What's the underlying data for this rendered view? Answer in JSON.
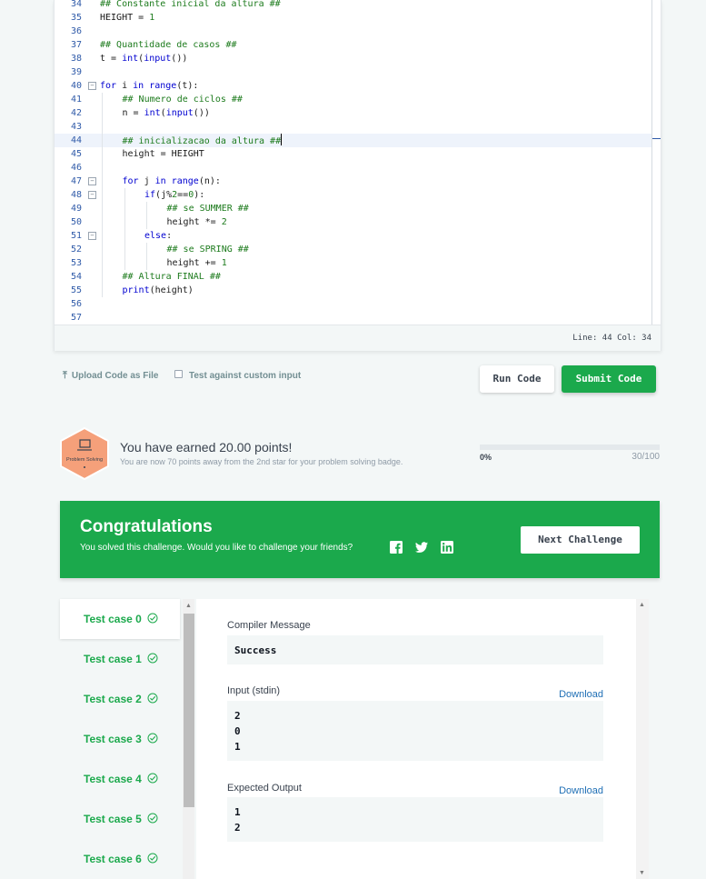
{
  "editor": {
    "lines": [
      {
        "num": "34",
        "indent": 0,
        "fold": false,
        "tokens": [
          {
            "t": "## Constante inicial da altura ##",
            "c": "c"
          }
        ]
      },
      {
        "num": "35",
        "indent": 0,
        "fold": false,
        "tokens": [
          {
            "t": "HEIGHT = ",
            "c": ""
          },
          {
            "t": "1",
            "c": "n"
          }
        ]
      },
      {
        "num": "36",
        "indent": 0,
        "fold": false,
        "tokens": []
      },
      {
        "num": "37",
        "indent": 0,
        "fold": false,
        "tokens": [
          {
            "t": "## Quantidade de casos ##",
            "c": "c"
          }
        ]
      },
      {
        "num": "38",
        "indent": 0,
        "fold": false,
        "tokens": [
          {
            "t": "t = ",
            "c": ""
          },
          {
            "t": "int",
            "c": "f"
          },
          {
            "t": "(",
            "c": ""
          },
          {
            "t": "input",
            "c": "f"
          },
          {
            "t": "())",
            "c": ""
          }
        ]
      },
      {
        "num": "39",
        "indent": 0,
        "fold": false,
        "tokens": []
      },
      {
        "num": "40",
        "indent": 0,
        "fold": true,
        "tokens": [
          {
            "t": "for",
            "c": "k"
          },
          {
            "t": " i ",
            "c": ""
          },
          {
            "t": "in",
            "c": "k"
          },
          {
            "t": " ",
            "c": ""
          },
          {
            "t": "range",
            "c": "f"
          },
          {
            "t": "(t):",
            "c": ""
          }
        ]
      },
      {
        "num": "41",
        "indent": 1,
        "fold": false,
        "tokens": [
          {
            "t": "## Numero de ciclos ##",
            "c": "c"
          }
        ]
      },
      {
        "num": "42",
        "indent": 1,
        "fold": false,
        "tokens": [
          {
            "t": "n = ",
            "c": ""
          },
          {
            "t": "int",
            "c": "f"
          },
          {
            "t": "(",
            "c": ""
          },
          {
            "t": "input",
            "c": "f"
          },
          {
            "t": "())",
            "c": ""
          }
        ]
      },
      {
        "num": "43",
        "indent": 1,
        "fold": false,
        "tokens": []
      },
      {
        "num": "44",
        "indent": 1,
        "fold": false,
        "active": true,
        "tokens": [
          {
            "t": "## inicializacao da altura ##",
            "c": "c"
          }
        ]
      },
      {
        "num": "45",
        "indent": 1,
        "fold": false,
        "tokens": [
          {
            "t": "height = HEIGHT",
            "c": ""
          }
        ]
      },
      {
        "num": "46",
        "indent": 1,
        "fold": false,
        "tokens": []
      },
      {
        "num": "47",
        "indent": 1,
        "fold": true,
        "tokens": [
          {
            "t": "for",
            "c": "k"
          },
          {
            "t": " j ",
            "c": ""
          },
          {
            "t": "in",
            "c": "k"
          },
          {
            "t": " ",
            "c": ""
          },
          {
            "t": "range",
            "c": "f"
          },
          {
            "t": "(n):",
            "c": ""
          }
        ]
      },
      {
        "num": "48",
        "indent": 2,
        "fold": true,
        "tokens": [
          {
            "t": "if",
            "c": "k"
          },
          {
            "t": "(j%",
            "c": ""
          },
          {
            "t": "2",
            "c": "n"
          },
          {
            "t": "==",
            "c": ""
          },
          {
            "t": "0",
            "c": "n"
          },
          {
            "t": "):",
            "c": ""
          }
        ]
      },
      {
        "num": "49",
        "indent": 3,
        "fold": false,
        "tokens": [
          {
            "t": "## se SUMMER ##",
            "c": "c"
          }
        ]
      },
      {
        "num": "50",
        "indent": 3,
        "fold": false,
        "tokens": [
          {
            "t": "height *= ",
            "c": ""
          },
          {
            "t": "2",
            "c": "n"
          }
        ]
      },
      {
        "num": "51",
        "indent": 2,
        "fold": true,
        "tokens": [
          {
            "t": "else",
            "c": "k"
          },
          {
            "t": ":",
            "c": ""
          }
        ]
      },
      {
        "num": "52",
        "indent": 3,
        "fold": false,
        "tokens": [
          {
            "t": "## se SPRING ##",
            "c": "c"
          }
        ]
      },
      {
        "num": "53",
        "indent": 3,
        "fold": false,
        "tokens": [
          {
            "t": "height += ",
            "c": ""
          },
          {
            "t": "1",
            "c": "n"
          }
        ]
      },
      {
        "num": "54",
        "indent": 1,
        "fold": false,
        "tokens": [
          {
            "t": "## Altura FINAL ##",
            "c": "c"
          }
        ]
      },
      {
        "num": "55",
        "indent": 1,
        "fold": false,
        "tokens": [
          {
            "t": "print",
            "c": "f"
          },
          {
            "t": "(height)",
            "c": ""
          }
        ]
      },
      {
        "num": "56",
        "indent": 0,
        "fold": false,
        "tokens": []
      },
      {
        "num": "57",
        "indent": 0,
        "fold": false,
        "tokens": []
      }
    ],
    "status": "Line: 44 Col: 34"
  },
  "controls": {
    "upload_label": "Upload Code as File",
    "custom_input_label": "Test against custom input",
    "run_label": "Run Code",
    "submit_label": "Submit Code"
  },
  "points": {
    "badge_label": "Problem Solving",
    "title": "You have earned 20.00 points!",
    "subtitle": "You are now 70 points away from the 2nd star for your problem solving badge.",
    "progress_percent": 0,
    "progress_left": "0%",
    "progress_right": "30/100"
  },
  "congrats": {
    "title": "Congratulations",
    "subtitle": "You solved this challenge. Would you like to challenge your friends?",
    "next_label": "Next Challenge"
  },
  "tests": {
    "cases": [
      "Test case 0",
      "Test case 1",
      "Test case 2",
      "Test case 3",
      "Test case 4",
      "Test case 5",
      "Test case 6"
    ],
    "active_index": 0,
    "compiler_label": "Compiler Message",
    "compiler_value": "Success",
    "input_label": "Input (stdin)",
    "input_lines": [
      "2",
      "0",
      "1"
    ],
    "expected_label": "Expected Output",
    "expected_lines": [
      "1",
      "2"
    ],
    "download_label": "Download"
  },
  "colors": {
    "green": "#1ba94c",
    "link": "#1f6fb5",
    "badge": "#f5a07a"
  }
}
